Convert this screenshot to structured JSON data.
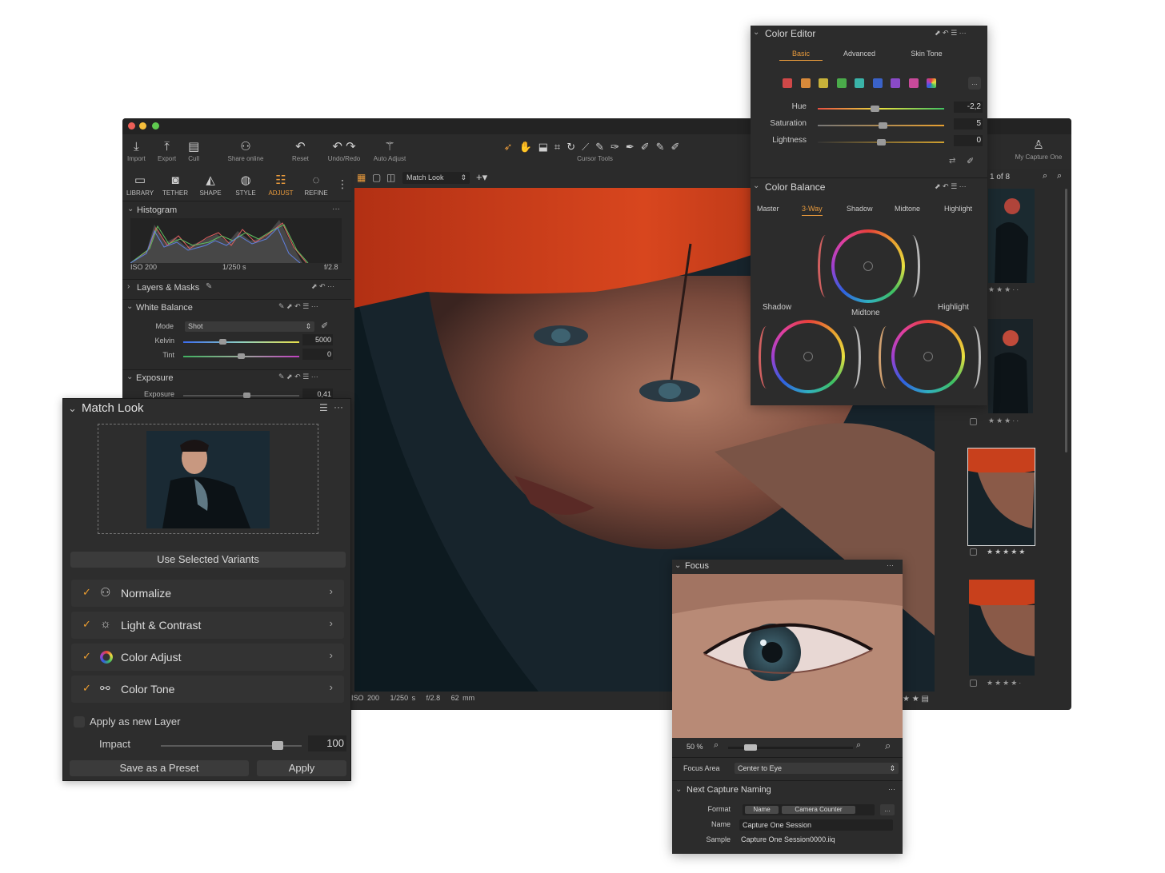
{
  "toolbar": {
    "import": "Import",
    "export": "Export",
    "cull": "Cull",
    "share": "Share online",
    "reset": "Reset",
    "undo_redo": "Undo/Redo",
    "auto_adjust": "Auto Adjust",
    "cursor_tools": "Cursor Tools",
    "user": "My Capture One"
  },
  "tabs": [
    {
      "label": "LIBRARY"
    },
    {
      "label": "TETHER"
    },
    {
      "label": "SHAPE"
    },
    {
      "label": "STYLE"
    },
    {
      "label": "ADJUST",
      "active": true
    },
    {
      "label": "REFINE"
    }
  ],
  "viewer_bar": {
    "preset": "Match Look",
    "count": "1 of 8"
  },
  "histogram": {
    "title": "Histogram",
    "iso": "ISO 200",
    "shutter": "1/250 s",
    "aperture": "f/2.8"
  },
  "layers": {
    "title": "Layers & Masks"
  },
  "white_balance": {
    "title": "White Balance",
    "mode_label": "Mode",
    "mode_value": "Shot",
    "kelvin_label": "Kelvin",
    "kelvin_value": "5000",
    "kelvin_level": 0.33,
    "tint_label": "Tint",
    "tint_value": "0",
    "tint_level": 0.5
  },
  "exposure": {
    "title": "Exposure",
    "label": "Exposure",
    "value": "0,41",
    "level": 0.55
  },
  "viewer_info": {
    "iso": "ISO 200",
    "shutter": "1/250 s",
    "aperture": "f/2.8",
    "focal": "62 mm"
  },
  "match_look": {
    "title": "Match Look",
    "use_selected": "Use Selected Variants",
    "rows": [
      {
        "label": "Normalize",
        "icon": "normalize-icon"
      },
      {
        "label": "Light & Contrast",
        "icon": "light-icon"
      },
      {
        "label": "Color Adjust",
        "icon": "color-wheel-icon"
      },
      {
        "label": "Color Tone",
        "icon": "color-tone-icon"
      }
    ],
    "apply_layer": "Apply as new Layer",
    "impact_label": "Impact",
    "impact_value": "100",
    "save_preset": "Save as a Preset",
    "apply": "Apply"
  },
  "color_editor": {
    "title": "Color Editor",
    "tabs": [
      "Basic",
      "Advanced",
      "Skin Tone"
    ],
    "active_tab": "Basic",
    "swatches": [
      "#d04848",
      "#d88a3a",
      "#c8b23a",
      "#4aab4a",
      "#3ab3a8",
      "#3a62c8",
      "#8a4ac8",
      "#c84a9a"
    ],
    "hue_label": "Hue",
    "hue_value": "-2,2",
    "hue_level": 0.45,
    "sat_label": "Saturation",
    "sat_value": "5",
    "sat_level": 0.52,
    "light_label": "Lightness",
    "light_value": "0",
    "light_level": 0.5
  },
  "color_balance": {
    "title": "Color Balance",
    "tabs": [
      "Master",
      "3-Way",
      "Shadow",
      "Midtone",
      "Highlight"
    ],
    "active_tab": "3-Way",
    "shadow": "Shadow",
    "midtone": "Midtone",
    "highlight": "Highlight"
  },
  "focus": {
    "title": "Focus",
    "zoom": "50 %",
    "focus_area_label": "Focus Area",
    "focus_area_value": "Center to Eye"
  },
  "naming": {
    "title": "Next Capture Naming",
    "format_label": "Format",
    "format_tokens": [
      "Name",
      "Camera Counter"
    ],
    "name_label": "Name",
    "name_value": "Capture One Session",
    "sample_label": "Sample",
    "sample_value": "Capture One Session0000.iiq"
  },
  "thumbs": [
    {
      "stars": "★★★··"
    },
    {
      "stars": "★★★··"
    },
    {
      "stars": "★★★★★"
    },
    {
      "stars": "★★★★·"
    }
  ]
}
